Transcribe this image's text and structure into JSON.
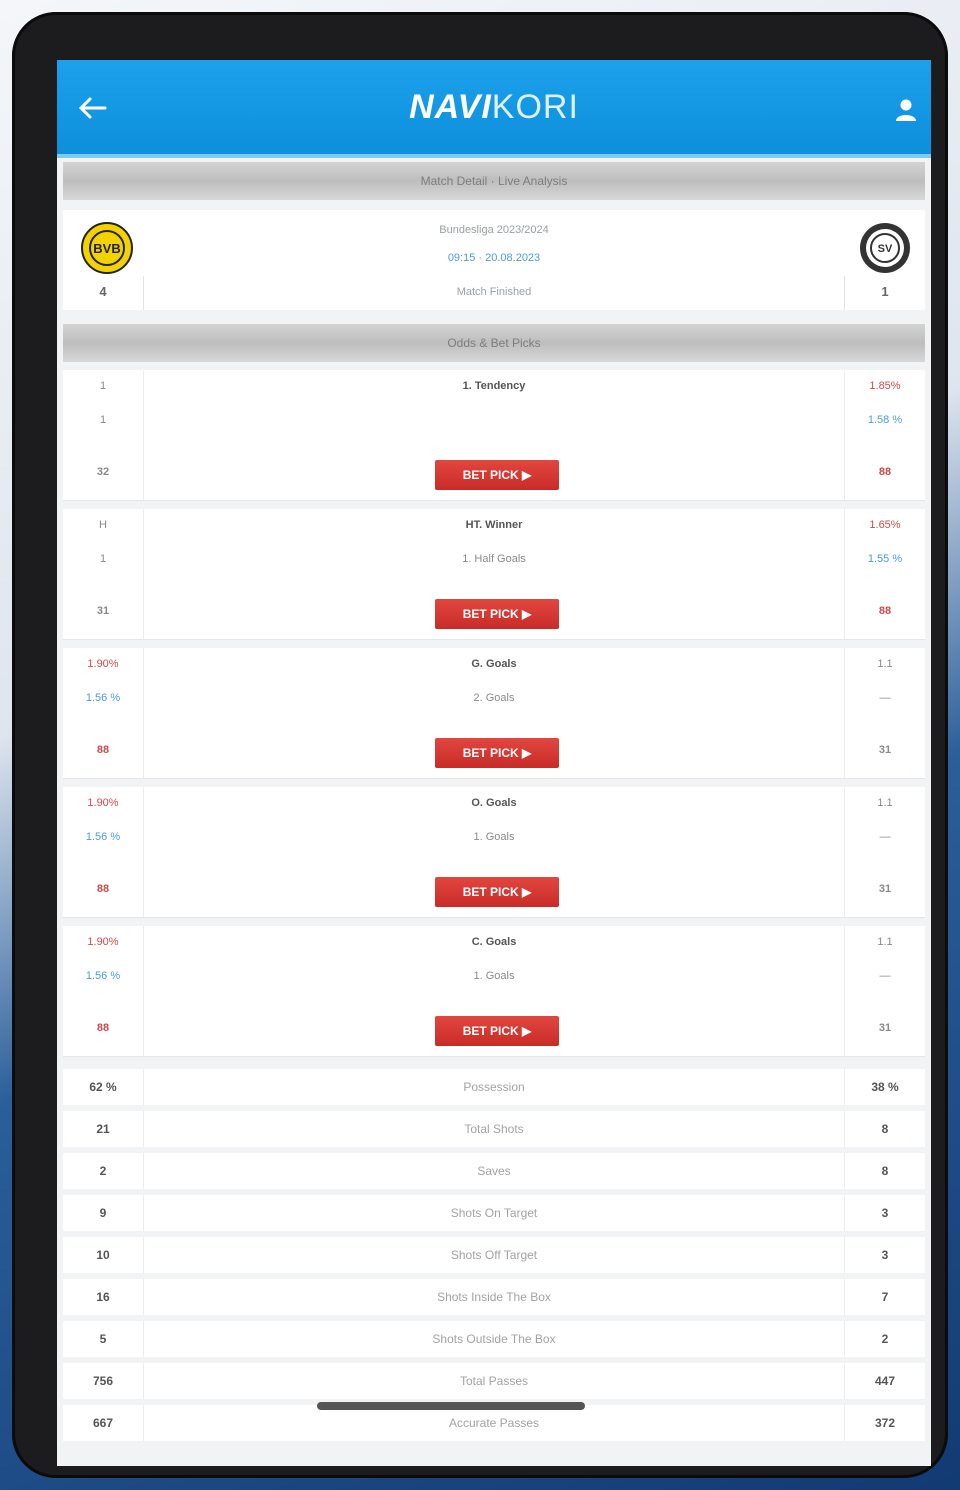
{
  "app": {
    "logo_bold": "NAVI",
    "logo_rest": "KORI"
  },
  "header": {
    "match_section": "Match Detail · Live Analysis",
    "odds_section": "Odds & Bet Picks"
  },
  "match": {
    "league": "Bundesliga 2023/2024",
    "datetime": "09:15 · 20.08.2023",
    "status": "Match Finished",
    "home_score": "4",
    "away_score": "1",
    "home_logo_text": "BVB",
    "away_logo_text": "SV"
  },
  "odds": [
    {
      "l1": "1",
      "l2": "1",
      "l_badge": "32",
      "mid1": "1. Tendency",
      "mid2": "",
      "r1": "1.85%",
      "r2": "1.58 %",
      "r_badge": "88",
      "bet": "BET PICK ▶"
    },
    {
      "l1": "H",
      "l2": "1",
      "l_badge": "31",
      "mid1": "HT. Winner",
      "mid2": "1. Half Goals",
      "r1": "1.65%",
      "r2": "1.55 %",
      "r_badge": "88",
      "bet": "BET PICK ▶"
    },
    {
      "l1": "1.90%",
      "l2": "1.56 %",
      "l_badge": "88",
      "mid1": "G. Goals",
      "mid2": "2. Goals",
      "r1": "1.1",
      "r2": "—",
      "r_badge": "31",
      "bet": "BET PICK ▶"
    },
    {
      "l1": "1.90%",
      "l2": "1.56 %",
      "l_badge": "88",
      "mid1": "O. Goals",
      "mid2": "1. Goals",
      "r1": "1.1",
      "r2": "—",
      "r_badge": "31",
      "bet": "BET PICK ▶"
    },
    {
      "l1": "1.90%",
      "l2": "1.56 %",
      "l_badge": "88",
      "mid1": "C. Goals",
      "mid2": "1. Goals",
      "r1": "1.1",
      "r2": "—",
      "r_badge": "31",
      "bet": "BET PICK ▶"
    }
  ],
  "stats": [
    {
      "label": "Possession",
      "home": "62 %",
      "away": "38 %"
    },
    {
      "label": "Total Shots",
      "home": "21",
      "away": "8"
    },
    {
      "label": "Saves",
      "home": "2",
      "away": "8"
    },
    {
      "label": "Shots On Target",
      "home": "9",
      "away": "3"
    },
    {
      "label": "Shots Off Target",
      "home": "10",
      "away": "3"
    },
    {
      "label": "Shots Inside The Box",
      "home": "16",
      "away": "7"
    },
    {
      "label": "Shots Outside The Box",
      "home": "5",
      "away": "2"
    },
    {
      "label": "Total Passes",
      "home": "756",
      "away": "447"
    },
    {
      "label": "Accurate Passes",
      "home": "667",
      "away": "372"
    }
  ]
}
